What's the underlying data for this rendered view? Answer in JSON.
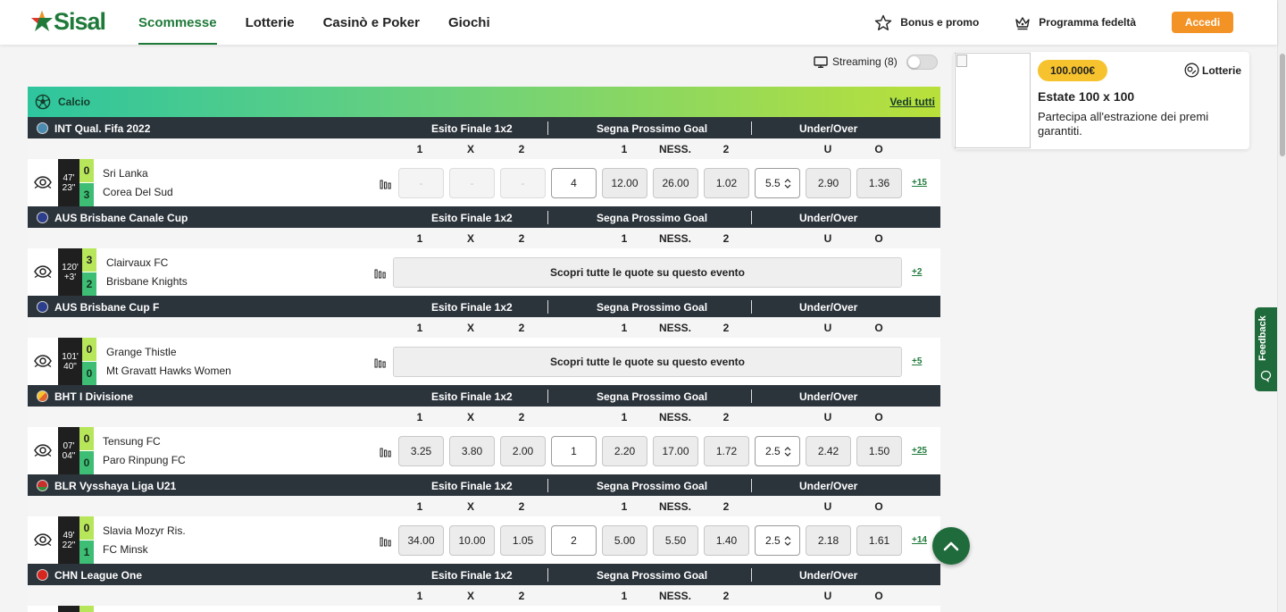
{
  "header": {
    "logo_text": "Sisal",
    "nav": [
      "Scommesse",
      "Lotterie",
      "Casinò e Poker",
      "Giochi"
    ],
    "bonus_label": "Bonus e promo",
    "loyalty_label": "Programma fedeltà",
    "login_label": "Accedi"
  },
  "streaming": {
    "label": "Streaming (8)",
    "enabled": false
  },
  "sport": {
    "name": "Calcio",
    "see_all": "Vedi tutti"
  },
  "market_headers": {
    "m1": "Esito Finale 1x2",
    "m2": "Segna Prossimo Goal",
    "m3": "Under/Over"
  },
  "sel_headers": {
    "s1": "1",
    "sx": "X",
    "s2": "2",
    "g1": "1",
    "gn": "NESS.",
    "g2": "2",
    "u": "U",
    "o": "O"
  },
  "discover_label": "Scopri tutte le quote su questo evento",
  "leagues": [
    {
      "name": "INT Qual. Fifa 2022",
      "flag_color": "#4a8bb0",
      "event": {
        "min": "47'",
        "sec": "23\"",
        "home": "Sri Lanka",
        "away": "Corea Del Sud",
        "home_score": "0",
        "away_score": "3",
        "odds": [
          "-",
          "-",
          "-",
          "4",
          "12.00",
          "26.00",
          "1.02",
          "5.5",
          "2.90",
          "1.36"
        ],
        "more": "+15"
      }
    },
    {
      "name": "AUS Brisbane Canale Cup",
      "flag_color": "#2c3e8c",
      "event": {
        "min": "120'",
        "sec": "+3'",
        "home": "Clairvaux FC",
        "away": "Brisbane Knights",
        "home_score": "3",
        "away_score": "2",
        "odds": [],
        "more": "+2"
      }
    },
    {
      "name": "AUS Brisbane Cup F",
      "flag_color": "#2c3e8c",
      "event": {
        "min": "101'",
        "sec": "40\"",
        "home": "Grange Thistle",
        "away": "Mt Gravatt Hawks Women",
        "home_score": "0",
        "away_score": "0",
        "odds": [],
        "more": "+5"
      }
    },
    {
      "name": "BHT I Divisione",
      "flag_color": "#f2a33a",
      "event": {
        "min": "07'",
        "sec": "04\"",
        "home": "Tensung FC",
        "away": "Paro Rinpung FC",
        "home_score": "0",
        "away_score": "0",
        "odds": [
          "3.25",
          "3.80",
          "2.00",
          "1",
          "2.20",
          "17.00",
          "1.72",
          "2.5",
          "2.42",
          "1.50"
        ],
        "more": "+25"
      }
    },
    {
      "name": "BLR Vysshaya Liga U21",
      "flag_color": "#c8302c",
      "event": {
        "min": "49'",
        "sec": "22\"",
        "home": "Slavia Mozyr Ris.",
        "away": "FC Minsk",
        "home_score": "0",
        "away_score": "1",
        "odds": [
          "34.00",
          "10.00",
          "1.05",
          "2",
          "5.00",
          "5.50",
          "1.40",
          "2.5",
          "2.18",
          "1.61"
        ],
        "more": "+14"
      }
    },
    {
      "name": "CHN League One",
      "flag_color": "#d6261f"
    }
  ],
  "lottery_card": {
    "badge": "100.000€",
    "category": "Lotterie",
    "title": "Estate 100 x 100",
    "description": "Partecipa all'estrazione dei premi garantiti."
  },
  "feedback_label": "Feedback"
}
